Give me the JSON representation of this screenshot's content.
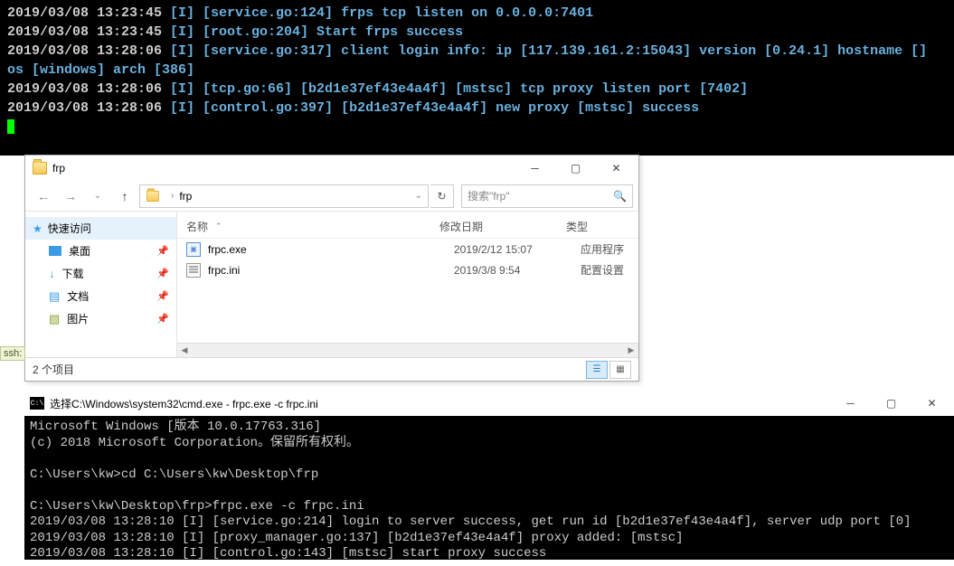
{
  "top_terminal": {
    "lines": [
      {
        "ts": "2019/03/08 13:23:45",
        "body": " [I] [service.go:124] frps tcp listen on 0.0.0.0:7401"
      },
      {
        "ts": "2019/03/08 13:23:45",
        "body": " [I] [root.go:204] Start frps success"
      },
      {
        "ts": "2019/03/08 13:28:06",
        "body": " [I] [service.go:317] client login info: ip [117.139.161.2:15043] version [0.24.1] hostname [] os [windows] arch [386]"
      },
      {
        "ts": "2019/03/08 13:28:06",
        "body": " [I] [tcp.go:66] [b2d1e37ef43e4a4f] [mstsc] tcp proxy listen port [7402]"
      },
      {
        "ts": "2019/03/08 13:28:06",
        "body": " [I] [control.go:397] [b2d1e37ef43e4a4f] new proxy [mstsc] success"
      }
    ]
  },
  "explorer": {
    "title": "frp",
    "breadcrumb": "frp",
    "search_placeholder": "搜索\"frp\"",
    "sidebar": {
      "quick_access": "快速访问",
      "items": [
        {
          "label": "桌面"
        },
        {
          "label": "下载"
        },
        {
          "label": "文档"
        },
        {
          "label": "图片"
        }
      ]
    },
    "columns": {
      "name": "名称",
      "date": "修改日期",
      "type": "类型"
    },
    "files": [
      {
        "name": "frpc.exe",
        "date": "2019/2/12 15:07",
        "type": "应用程序",
        "kind": "exe"
      },
      {
        "name": "frpc.ini",
        "date": "2019/3/8 9:54",
        "type": "配置设置",
        "kind": "ini"
      }
    ],
    "status": "2 个项目"
  },
  "ssh_tag": "ssh:",
  "cmd": {
    "title": "选择C:\\Windows\\system32\\cmd.exe - frpc.exe  -c frpc.ini",
    "lines": [
      "Microsoft Windows [版本 10.0.17763.316]",
      "(c) 2018 Microsoft Corporation。保留所有权利。",
      "",
      "C:\\Users\\kw>cd C:\\Users\\kw\\Desktop\\frp",
      "",
      "C:\\Users\\kw\\Desktop\\frp>frpc.exe -c frpc.ini",
      "2019/03/08 13:28:10 [I] [service.go:214] login to server success, get run id [b2d1e37ef43e4a4f], server udp port [0]",
      "2019/03/08 13:28:10 [I] [proxy_manager.go:137] [b2d1e37ef43e4a4f] proxy added: [mstsc]",
      "2019/03/08 13:28:10 [I] [control.go:143] [mstsc] start proxy success"
    ]
  }
}
